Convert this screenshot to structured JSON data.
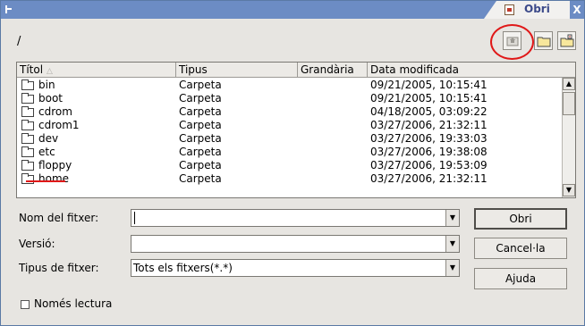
{
  "window": {
    "title": "Obri",
    "system_icon": "window-menu-icon",
    "close_icon": "close-icon",
    "close_glyph": "X",
    "title_icon": "document-icon"
  },
  "toolbar": {
    "path": "/",
    "buttons": [
      "up-folder-icon",
      "new-folder-icon",
      "default-directory-icon"
    ]
  },
  "file_list": {
    "columns": [
      "Títol",
      "Tipus",
      "Grandària",
      "Data modificada"
    ],
    "sort_indicator": "△",
    "rows": [
      {
        "name": "bin",
        "type": "Carpeta",
        "size": "",
        "date": "09/21/2005, 10:15:41"
      },
      {
        "name": "boot",
        "type": "Carpeta",
        "size": "",
        "date": "09/21/2005, 10:15:41"
      },
      {
        "name": "cdrom",
        "type": "Carpeta",
        "size": "",
        "date": "04/18/2005, 03:09:22"
      },
      {
        "name": "cdrom1",
        "type": "Carpeta",
        "size": "",
        "date": "03/27/2006, 21:32:11"
      },
      {
        "name": "dev",
        "type": "Carpeta",
        "size": "",
        "date": "03/27/2006, 19:33:03"
      },
      {
        "name": "etc",
        "type": "Carpeta",
        "size": "",
        "date": "03/27/2006, 19:38:08"
      },
      {
        "name": "floppy",
        "type": "Carpeta",
        "size": "",
        "date": "03/27/2006, 19:53:09"
      },
      {
        "name": "home",
        "type": "Carpeta",
        "size": "",
        "date": "03/27/2006, 21:32:11"
      }
    ],
    "scroll_up_glyph": "▲",
    "scroll_down_glyph": "▼"
  },
  "form": {
    "filename": {
      "label": "Nom del fitxer:",
      "value": ""
    },
    "version": {
      "label": "Versió:",
      "value": ""
    },
    "filetype": {
      "label": "Tipus de fitxer:",
      "value": "Tots els fitxers(*.*)"
    },
    "dropdown_glyph": "▼"
  },
  "buttons": {
    "open": "Obri",
    "cancel": "Cancel·la",
    "help": "Ajuda"
  },
  "readonly": {
    "label": "Només lectura",
    "checked": false
  },
  "colors": {
    "titlebar": "#6c8cc4",
    "annotation": "#e01818",
    "window_bg": "#e7e5e1"
  }
}
